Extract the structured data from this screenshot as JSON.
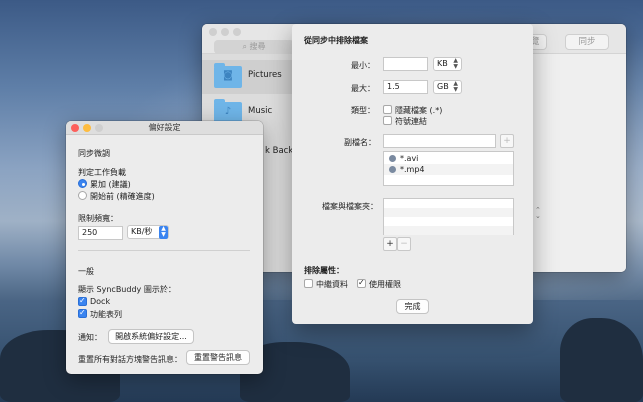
{
  "main_window": {
    "search_placeholder": "搜尋",
    "sidebar_items": [
      {
        "label": "Pictures",
        "icon": "camera-icon"
      },
      {
        "label": "Music",
        "icon": "music-note-icon"
      }
    ],
    "partial_item": "k Backup",
    "toolbar": {
      "preview_label": "覽",
      "sync_label": "同步"
    }
  },
  "exclude_sheet": {
    "title": "從同步中排除檔案",
    "min_label": "最小：",
    "min_value": "",
    "min_unit": "KB",
    "max_label": "最大：",
    "max_value": "1.5",
    "max_unit": "GB",
    "type_label": "類型：",
    "hidden_files_label": "隱藏檔案 (.*)",
    "symlinks_label": "符號連結",
    "extension_label": "副檔名：",
    "extension_value": "",
    "extensions": [
      "*.avi",
      "*.mp4"
    ],
    "files_folders_label": "檔案與檔案夾：",
    "add_symbol": "+",
    "remove_symbol": "−",
    "exclude_attrs_label": "排除屬性：",
    "metadata_label": "中繼資料",
    "permissions_label": "使用權限",
    "done_label": "完成"
  },
  "prefs_window": {
    "title": "偏好設定",
    "sync_tuning_heading": "同步微調",
    "workload_label": "判定工作負載",
    "radio_accumulate": "累加 (建議)",
    "radio_before_start": "開始前 (精確進度)",
    "bandwidth_label": "限制頻寬：",
    "bandwidth_value": "250",
    "bandwidth_unit": "KB/秒",
    "general_heading": "一般",
    "show_in_label": "顯示 SyncBuddy 圖示於：",
    "dock_label": "Dock",
    "menubar_label": "功能表列",
    "notify_label": "通知：",
    "open_prefs_button": "開啟系統偏好設定...",
    "reset_label": "重置所有對話方塊警告訊息：",
    "reset_button": "重置警告訊息"
  }
}
